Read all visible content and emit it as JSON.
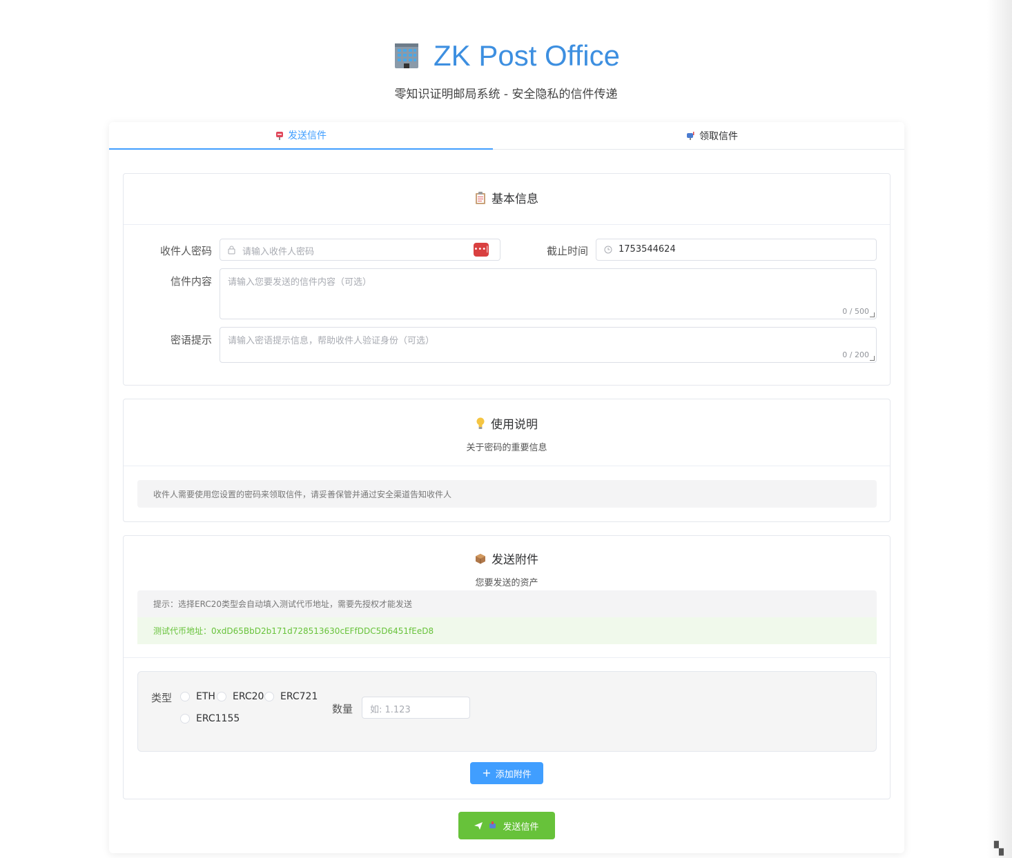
{
  "header": {
    "title": "ZK Post Office",
    "subtitle": "零知识证明邮局系统 - 安全隐私的信件传递"
  },
  "tabs": [
    {
      "label": "发送信件",
      "icon": "postbox-icon",
      "active": true
    },
    {
      "label": "领取信件",
      "icon": "mailbox-icon",
      "active": false
    }
  ],
  "basic_info": {
    "title": "基本信息",
    "icon": "clipboard-icon",
    "recipient_password": {
      "label": "收件人密码",
      "placeholder": "请输入收件人密码",
      "icon": "lock-icon",
      "side_icon": "password-manager-icon"
    },
    "deadline": {
      "label": "截止时间",
      "value": "1753544624",
      "icon": "clock-icon"
    },
    "letter_content": {
      "label": "信件内容",
      "placeholder": "请输入您要发送的信件内容（可选）",
      "counter": "0 / 500"
    },
    "password_hint": {
      "label": "密语提示",
      "placeholder": "请输入密语提示信息，帮助收件人验证身份（可选）",
      "counter": "0 / 200"
    }
  },
  "usage": {
    "title": "使用说明",
    "icon": "lightbulb-icon",
    "subtitle": "关于密码的重要信息",
    "note": "收件人需要使用您设置的密码来领取信件，请妥善保管并通过安全渠道告知收件人"
  },
  "attachments": {
    "title": "发送附件",
    "icon": "package-icon",
    "subtitle": "您要发送的资产",
    "tip": "提示：选择ERC20类型会自动填入测试代币地址，需要先授权才能发送",
    "token_address": "测试代币地址：0xdD65BbD2b171d728513630cEFfDDC5D6451fEeD8",
    "type_label": "类型",
    "types": [
      "ETH",
      "ERC20",
      "ERC721",
      "ERC1155"
    ],
    "amount_label": "数量",
    "amount_placeholder": "如: 1.123",
    "add_button": "添加附件"
  },
  "send_button": "发送信件",
  "colors": {
    "primary": "#409eff",
    "success": "#67c23a",
    "title": "#3d8fe0"
  }
}
